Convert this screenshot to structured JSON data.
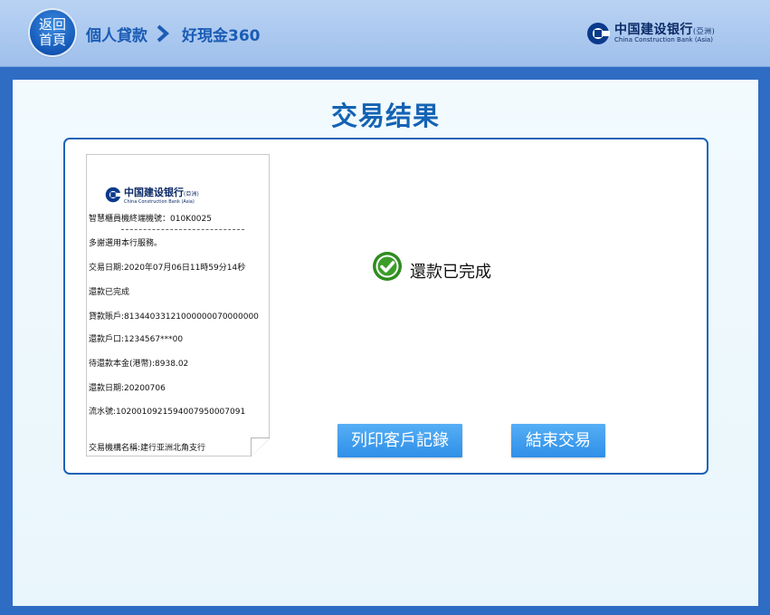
{
  "header": {
    "home_button": {
      "line1": "返回",
      "line2": "首頁"
    },
    "breadcrumb": [
      "個人貸款",
      "好現金360"
    ],
    "bank_logo": {
      "cn": "中国建设银行",
      "region": "(亞洲)",
      "en": "China Construction Bank (Asia)"
    }
  },
  "main": {
    "title": "交易结果",
    "status_text": "還款已完成",
    "print_button": "列印客戶記錄",
    "end_button": "結束交易"
  },
  "receipt": {
    "logo_cn": "中国建设银行",
    "logo_region": "(亞洲)",
    "logo_en": "China Construction Bank (Asia)",
    "lines": [
      "智慧櫃員機終端機號：010K0025",
      "多謝選用本行服務。",
      "交易日期:2020年07月06日11時59分14秒",
      "還款已完成",
      "貸款賬戶:8134403312100000007000000​0",
      "還款戶口:1234567***00",
      "待還款本金(港幣):8938.02",
      "還款日期:20200706",
      "流水號:10200109215940079500070​91",
      "交易機構名稱:建行亚洲北角支行"
    ]
  },
  "colors": {
    "accent": "#1463b4",
    "header_bg": "#a9c8f0",
    "button_bg": "#3f9cee",
    "success": "#2e8b1f"
  },
  "icons": {
    "status": "check-circle-icon",
    "breadcrumb_separator": "chevron-right-icon",
    "bank": "ccb-logo-icon"
  }
}
